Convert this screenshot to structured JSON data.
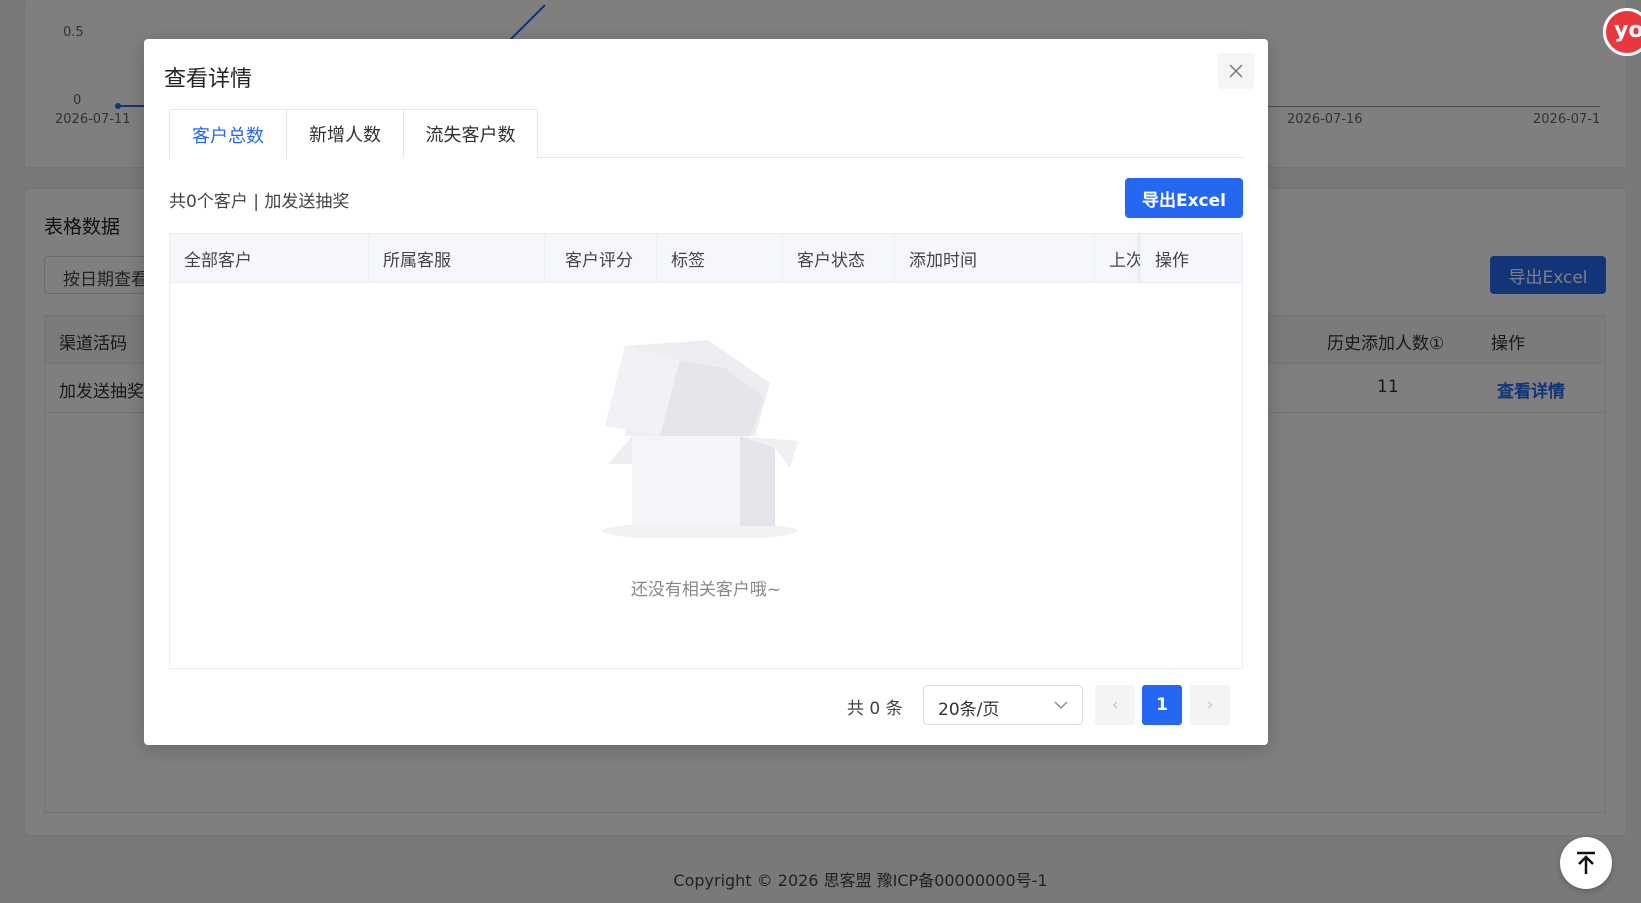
{
  "background": {
    "chart_y_ticks": [
      "0.5",
      "0"
    ],
    "chart_x_ticks": [
      "2026-07-11",
      "2026-07-16",
      "2026-07-1"
    ],
    "section_title": "表格数据",
    "date_button": "按日期查看",
    "export_label": "导出Excel",
    "table_headers": [
      "渠道活码",
      "历史添加人数①",
      "操作"
    ],
    "row": {
      "channel": "加发送抽奖",
      "history_count": "11",
      "action": "查看详情"
    },
    "footer": "Copyright © 2026 思客盟 豫ICP备00000000号-1"
  },
  "modal": {
    "title": "查看详情",
    "tabs": [
      {
        "label": "客户总数",
        "active": true
      },
      {
        "label": "新增人数",
        "active": false
      },
      {
        "label": "流失客户数",
        "active": false
      }
    ],
    "summary": "共0个客户 | 加发送抽奖",
    "export_label": "导出Excel",
    "columns": [
      "全部客户",
      "所属客服",
      "客户评分",
      "标签",
      "客户状态",
      "添加时间",
      "上次",
      "操作"
    ],
    "empty_text": "还没有相关客户哦~",
    "pagination": {
      "total": "共 0 条",
      "page_size": "20条/页",
      "current_page": "1",
      "prev": "‹",
      "next": "›"
    }
  },
  "icons": {
    "close": "close-icon",
    "logo": "yo",
    "back_to_top": "arrow-up-icon"
  },
  "colors": {
    "primary": "#2468f2",
    "overlay": "rgba(0,0,0,0.5)"
  }
}
